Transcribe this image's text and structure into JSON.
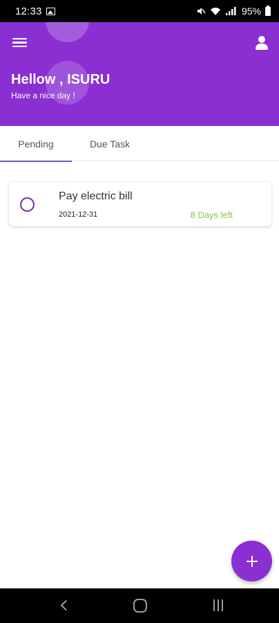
{
  "status_bar": {
    "time": "12:33",
    "battery": "95%",
    "icons": [
      "gallery-icon",
      "mute-icon",
      "wifi-icon",
      "signal-icon",
      "battery-icon"
    ]
  },
  "header": {
    "greeting": "Hellow , ISURU",
    "subtitle": "Have a nice day !",
    "background_color": "#8a2fd2",
    "left_icon": "menu-icon",
    "right_icon": "profile-icon"
  },
  "tabs": [
    {
      "label": "Pending",
      "active": true
    },
    {
      "label": "Due Task",
      "active": false
    }
  ],
  "tasks": [
    {
      "title": "Pay electric bill",
      "date": "2021-12-31",
      "remaining": "8 Days left",
      "completed": false,
      "remaining_color": "#8bc34a"
    }
  ],
  "fab": {
    "icon": "add-icon",
    "color": "#8a2fd2"
  },
  "nav_bar": {
    "icons": [
      "back-icon",
      "home-icon",
      "recents-icon"
    ]
  }
}
